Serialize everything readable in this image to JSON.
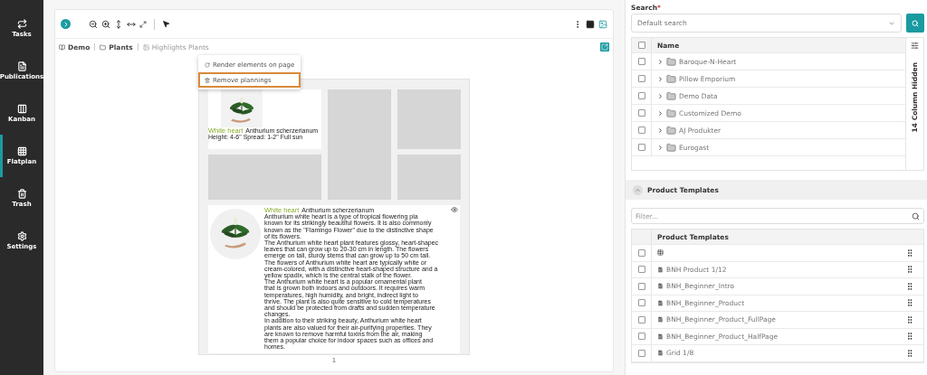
{
  "sidebar": {
    "items": [
      {
        "label": "Tasks",
        "selected": false
      },
      {
        "label": "Publications",
        "selected": false
      },
      {
        "label": "Kanban",
        "selected": false
      },
      {
        "label": "Flatplan",
        "selected": true
      },
      {
        "label": "Trash",
        "selected": false
      },
      {
        "label": "Settings",
        "selected": false
      }
    ]
  },
  "breadcrumb": [
    {
      "label": "Demo",
      "kind": "publication",
      "current": false
    },
    {
      "label": "Plants",
      "kind": "folder",
      "current": false
    },
    {
      "label": "Highlights Plants",
      "kind": "page",
      "current": true
    }
  ],
  "context_menu": [
    {
      "label": "Render elements on page",
      "kind": "render",
      "highlighted": false
    },
    {
      "label": "Remove plannings",
      "kind": "remove",
      "highlighted": true
    }
  ],
  "page": {
    "top_item": {
      "title": "White heart",
      "subtitle": "Anthurium scherzerianum",
      "text": "Height: 4-6\" Spread: 1-2\" Full sun"
    },
    "bottom_item": {
      "title": "White heart",
      "subtitle": "Anthurium scherzerianum",
      "lines": [
        "Anthurium white heart is a type of tropical flowering pla",
        "known for its strikingly beautiful flowers. It is also commonly",
        "known as the \"Flamingo Flower\" due to the distinctive shape",
        "of its flowers.",
        "The Anthurium white heart plant features glossy, heart-shapec",
        "leaves that can grow up to 20-30 cm in length. The flowers",
        "emerge on tall, sturdy stems that can grow up to 50 cm tall.",
        "The flowers of Anthurium white heart are typically white or",
        "cream-colored, with a distinctive heart-shaped structure and a",
        "yellow spadix, which is the central stalk of the flower.",
        "The Anthurium white heart is a popular ornamental plant",
        "that is grown both indoors and outdoors. It requires warm",
        "temperatures, high humidity, and bright, indirect light to",
        "thrive. The plant is also quite sensitive to cold temperatures",
        "and should be protected from drafts and sudden temperature",
        "changes.",
        "In addition to their striking beauty, Anthurium white heart",
        "plants are also valued for their air-purifying properties. They",
        "are known to remove harmful toxins from the air, making",
        "them a popular choice for indoor spaces such as offices and",
        "homes."
      ]
    },
    "page_number": "1"
  },
  "search": {
    "label": "Search",
    "required_mark": "*",
    "value": "Default search"
  },
  "tree": {
    "column": "Name",
    "all_checked": false,
    "hidden_columns": "14 Column Hidden",
    "rows": [
      {
        "name": "Baroque-N-Heart",
        "checked": false
      },
      {
        "name": "Pillow Emporium",
        "checked": false
      },
      {
        "name": "Demo Data",
        "checked": false
      },
      {
        "name": "Customized Demo",
        "checked": false
      },
      {
        "name": "AJ Produkter",
        "checked": false
      },
      {
        "name": "Eurogast",
        "checked": false
      }
    ]
  },
  "templates": {
    "title": "Product Templates",
    "expanded": true,
    "filter_placeholder": "Filter...",
    "column": "Product Templates",
    "rows": [
      {
        "kind": "layout",
        "checked": false
      },
      {
        "kind": "template",
        "name": "BNH Product 1/12",
        "checked": false
      },
      {
        "kind": "template",
        "name": "BNH_Beginner_Intro",
        "checked": false
      },
      {
        "kind": "template",
        "name": "BNH_Beginner_Product",
        "checked": false
      },
      {
        "kind": "template",
        "name": "BNH_Beginner_Product_FullPage",
        "checked": false
      },
      {
        "kind": "template",
        "name": "BNH_Beginner_Product_HalfPage",
        "checked": false
      },
      {
        "kind": "template",
        "name": "Grid 1/8",
        "checked": false
      }
    ]
  }
}
